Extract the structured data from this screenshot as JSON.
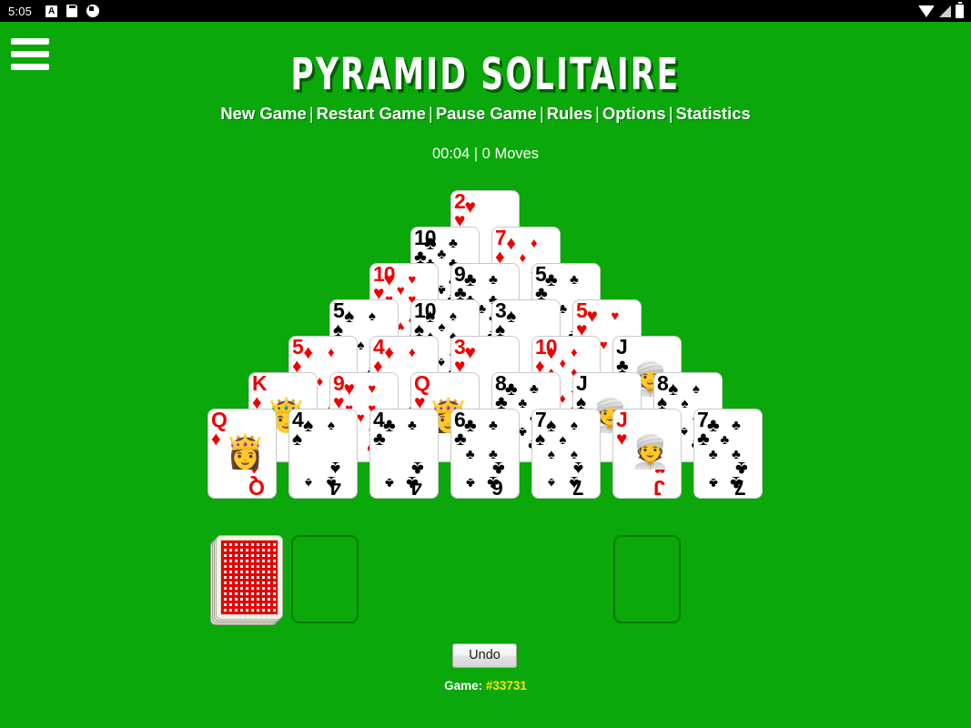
{
  "status_bar": {
    "clock": "5:05",
    "left_icons": [
      "letter-a-badge-icon",
      "sd-card-icon",
      "do-not-disturb-icon"
    ],
    "right_icons": [
      "wifi-icon",
      "cell-signal-icon",
      "battery-icon"
    ]
  },
  "header": {
    "menu_icon": "hamburger-menu-icon",
    "title": "PYRAMID SOLITAIRE"
  },
  "menu": {
    "separator": "|",
    "items": [
      {
        "label": "New Game"
      },
      {
        "label": "Restart Game"
      },
      {
        "label": "Pause Game"
      },
      {
        "label": "Rules"
      },
      {
        "label": "Options"
      },
      {
        "label": "Statistics"
      }
    ]
  },
  "game_status": {
    "timer": "00:04",
    "moves": "0 Moves",
    "text": "00:04 | 0 Moves"
  },
  "board": {
    "type": "pyramid-solitaire",
    "rows": [
      [
        {
          "rank": "2",
          "suit": "hearts"
        }
      ],
      [
        {
          "rank": "10",
          "suit": "clubs"
        },
        {
          "rank": "7",
          "suit": "diamonds"
        }
      ],
      [
        {
          "rank": "10",
          "suit": "hearts"
        },
        {
          "rank": "9",
          "suit": "clubs"
        },
        {
          "rank": "5",
          "suit": "clubs"
        }
      ],
      [
        {
          "rank": "5",
          "suit": "spades"
        },
        {
          "rank": "10",
          "suit": "spades"
        },
        {
          "rank": "3",
          "suit": "spades"
        },
        {
          "rank": "5",
          "suit": "hearts"
        }
      ],
      [
        {
          "rank": "5",
          "suit": "diamonds"
        },
        {
          "rank": "4",
          "suit": "diamonds"
        },
        {
          "rank": "3",
          "suit": "hearts"
        },
        {
          "rank": "10",
          "suit": "diamonds"
        },
        {
          "rank": "J",
          "suit": "clubs"
        }
      ],
      [
        {
          "rank": "K",
          "suit": "diamonds"
        },
        {
          "rank": "9",
          "suit": "hearts"
        },
        {
          "rank": "Q",
          "suit": "hearts"
        },
        {
          "rank": "8",
          "suit": "clubs"
        },
        {
          "rank": "J",
          "suit": "spades"
        },
        {
          "rank": "8",
          "suit": "spades"
        }
      ],
      [
        {
          "rank": "Q",
          "suit": "diamonds"
        },
        {
          "rank": "4",
          "suit": "spades"
        },
        {
          "rank": "4",
          "suit": "clubs"
        },
        {
          "rank": "6",
          "suit": "clubs"
        },
        {
          "rank": "7",
          "suit": "spades"
        },
        {
          "rank": "J",
          "suit": "hearts"
        },
        {
          "rank": "7",
          "suit": "clubs"
        }
      ]
    ]
  },
  "piles": {
    "stock": {
      "name": "stock-pile",
      "face_down": true,
      "back_color": "#e60000"
    },
    "waste": {
      "name": "waste-pile",
      "empty": true
    },
    "foundation": {
      "name": "foundation-pile",
      "empty": true
    }
  },
  "controls": {
    "undo_label": "Undo"
  },
  "footer": {
    "game_label": "Game:",
    "game_number": "#33731"
  },
  "colors": {
    "table_green": "#0aa80a",
    "red_suit": "#ee0000",
    "black_suit": "#000000",
    "accent_yellow": "#ffe500",
    "status_bar": "#000000"
  }
}
